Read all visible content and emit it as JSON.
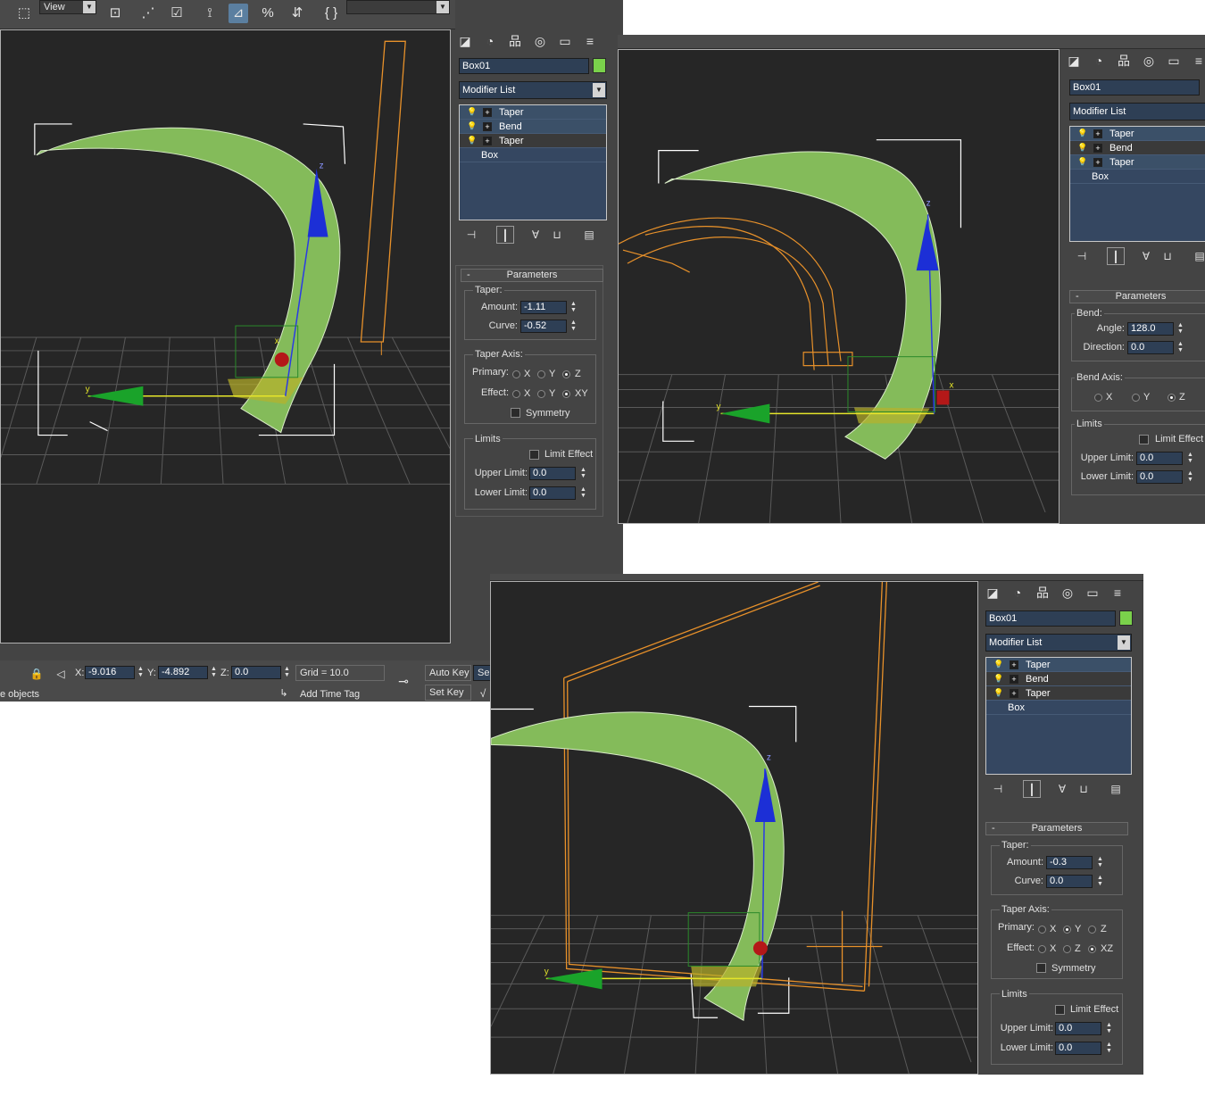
{
  "toolbar": {
    "view_dropdown": "View"
  },
  "common": {
    "object_name": "Box01",
    "modifier_list": "Modifier List",
    "stack": [
      "Taper",
      "Bend",
      "Taper"
    ],
    "stack_base": "Box",
    "rollout_title": "Parameters",
    "limits_group": "Limits",
    "limit_effect": "Limit Effect",
    "upper_limit": "Upper Limit:",
    "lower_limit": "Lower Limit:",
    "symmetry": "Symmetry"
  },
  "shot1": {
    "taper_group": "Taper:",
    "amount_label": "Amount:",
    "amount_value": "-1.11",
    "curve_label": "Curve:",
    "curve_value": "-0.52",
    "taper_axis_group": "Taper Axis:",
    "primary_label": "Primary:",
    "primary_options": [
      "X",
      "Y",
      "Z"
    ],
    "primary_selected": "Z",
    "effect_label": "Effect:",
    "effect_options": [
      "X",
      "Y",
      "XY"
    ],
    "effect_selected": "XY",
    "upper_value": "0.0",
    "lower_value": "0.0",
    "status": {
      "x_label": "X:",
      "x_value": "-9.016",
      "y_label": "Y:",
      "y_value": "-4.892",
      "z_label": "Z:",
      "z_value": "0.0",
      "grid": "Grid = 10.0",
      "auto_key": "Auto Key",
      "set_key": "Set Key",
      "sel_partial": "Sel",
      "objects_partial": "e objects",
      "add_time_tag": "Add Time Tag"
    }
  },
  "shot2": {
    "bend_group": "Bend:",
    "angle_label": "Angle:",
    "angle_value": "128.0",
    "direction_label": "Direction:",
    "direction_value": "0.0",
    "bend_axis_group": "Bend Axis:",
    "axis_options": [
      "X",
      "Y",
      "Z"
    ],
    "axis_selected": "Z",
    "upper_value": "0.0",
    "lower_value": "0.0"
  },
  "shot3": {
    "taper_group": "Taper:",
    "amount_label": "Amount:",
    "amount_value": "-0.3",
    "curve_label": "Curve:",
    "curve_value": "0.0",
    "taper_axis_group": "Taper Axis:",
    "primary_label": "Primary:",
    "primary_options": [
      "X",
      "Y",
      "Z"
    ],
    "primary_selected": "Y",
    "effect_label": "Effect:",
    "effect_options": [
      "X",
      "Z",
      "XZ"
    ],
    "effect_selected": "XZ",
    "upper_value": "0.0",
    "lower_value": "0.0"
  },
  "viewport_labels": {
    "x": "x",
    "y": "y",
    "z": "z"
  }
}
